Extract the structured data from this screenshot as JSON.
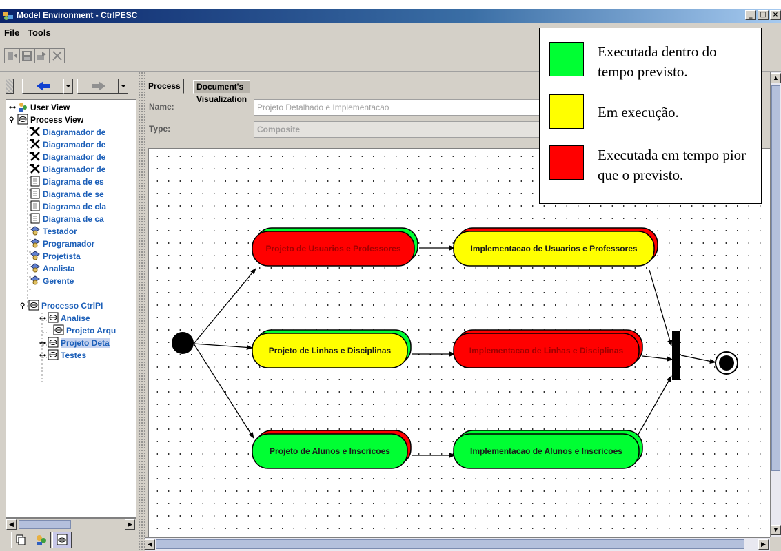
{
  "window": {
    "title": "Model Environment - CtrlPESC",
    "buttons": [
      "_",
      "□",
      "×"
    ]
  },
  "menu": [
    {
      "label": "File"
    },
    {
      "label": "Tools"
    }
  ],
  "toolbar": {
    "buttons": [
      "import-icon",
      "save-icon",
      "export-icon",
      "close-icon"
    ]
  },
  "tree": {
    "items": [
      {
        "label": "User View",
        "icon": "users-icon"
      },
      {
        "label": "Process View",
        "icon": "process-icon"
      },
      {
        "label": "Diagramador de",
        "icon": "tools-icon"
      },
      {
        "label": "Diagramador de",
        "icon": "tools-icon"
      },
      {
        "label": "Diagramador de",
        "icon": "tools-icon"
      },
      {
        "label": "Diagramador de",
        "icon": "tools-icon"
      },
      {
        "label": "Diagrama de es",
        "icon": "document-icon"
      },
      {
        "label": "Diagrama de se",
        "icon": "document-icon"
      },
      {
        "label": "Diagrama de cla",
        "icon": "document-icon"
      },
      {
        "label": "Diagrama de ca",
        "icon": "document-icon"
      },
      {
        "label": "Testador",
        "icon": "role-icon"
      },
      {
        "label": "Programador",
        "icon": "role-icon"
      },
      {
        "label": "Projetista",
        "icon": "role-icon"
      },
      {
        "label": "Analista",
        "icon": "role-icon"
      },
      {
        "label": "Gerente",
        "icon": "role-icon"
      },
      {
        "label": "Processo CtrlPI",
        "icon": "process-icon"
      },
      {
        "label": "Analise",
        "icon": "process-icon"
      },
      {
        "label": "Projeto Arqu",
        "icon": "process-icon"
      },
      {
        "label": "Projeto Deta",
        "icon": "process-icon"
      },
      {
        "label": "Testes",
        "icon": "process-icon"
      }
    ]
  },
  "tabs": [
    {
      "label": "Process"
    },
    {
      "label": "Document's Visualization"
    }
  ],
  "form": {
    "name_label": "Name:",
    "name_value": "Projeto Detalhado e Implementacao",
    "type_label": "Type:",
    "type_value": "Composite"
  },
  "colors": {
    "green": "#00ff33",
    "yellow": "#ffff00",
    "red": "#ff0000"
  },
  "activities": [
    {
      "label": "Projeto de Usuarios e Professores",
      "fill": "red",
      "shadow": "green"
    },
    {
      "label": "Implementacao de Usuarios e Professores",
      "fill": "yellow",
      "shadow": "red"
    },
    {
      "label": "Projeto de Linhas e Disciplinas",
      "fill": "yellow",
      "shadow": "green"
    },
    {
      "label": "Implementacao de Linhas e Disciplinas",
      "fill": "red",
      "shadow": "red"
    },
    {
      "label": "Projeto de Alunos e Inscricoes",
      "fill": "green",
      "shadow": "red"
    },
    {
      "label": "Implementacao de Alunos e Inscricoes",
      "fill": "green",
      "shadow": "green"
    }
  ],
  "legend": [
    {
      "color": "green",
      "text": "Executada dentro do tempo previsto."
    },
    {
      "color": "yellow",
      "text": "Em execução."
    },
    {
      "color": "red",
      "text": "Executada em tempo pior que o previsto."
    }
  ]
}
